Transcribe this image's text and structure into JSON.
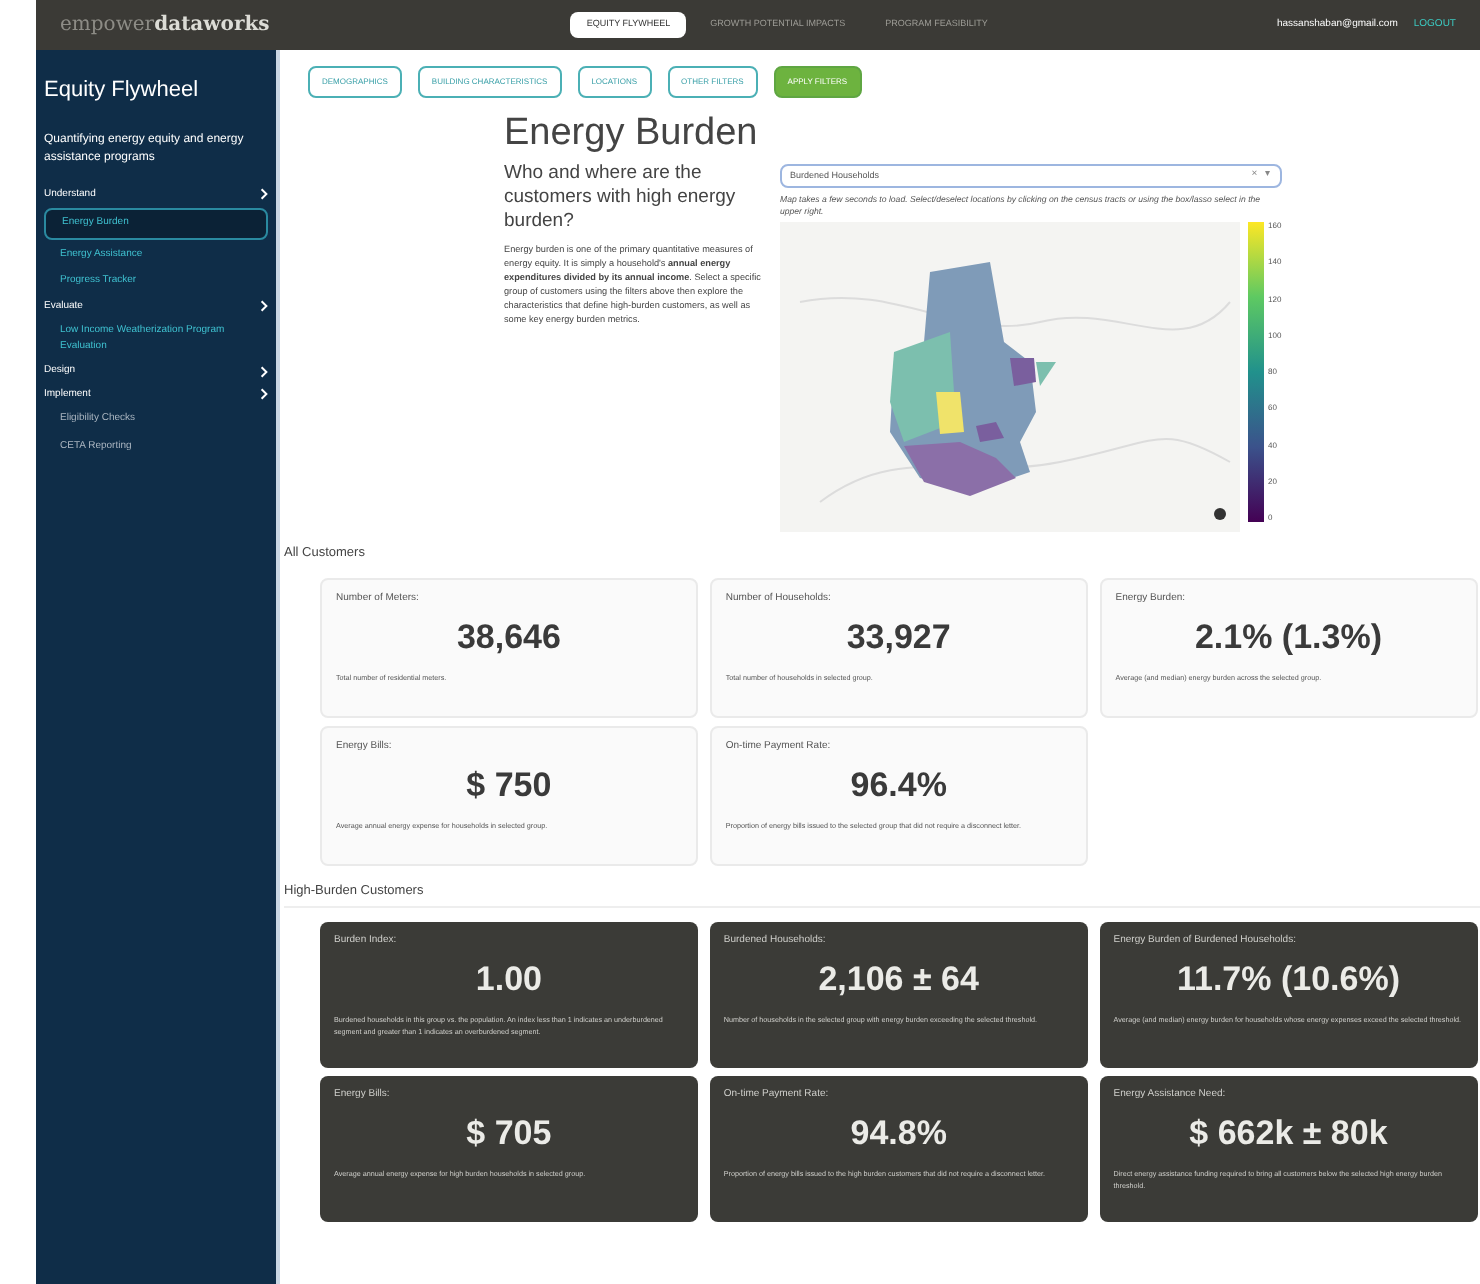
{
  "header": {
    "logo_light": "empower",
    "logo_bold": "dataworks",
    "tabs": [
      {
        "label": "EQUITY FLYWHEEL",
        "selected": true
      },
      {
        "label": "GROWTH POTENTIAL IMPACTS",
        "selected": false
      },
      {
        "label": "PROGRAM FEASIBILITY",
        "selected": false
      }
    ],
    "email": "hassanshaban@gmail.com",
    "logout": "LOGOUT"
  },
  "sidebar": {
    "title": "Equity Flywheel",
    "subtitle": "Quantifying energy equity and energy assistance programs",
    "items": [
      {
        "label": "Understand",
        "children": [
          {
            "label": "Energy Burden",
            "selected": true
          },
          {
            "label": "Energy Assistance",
            "selected": false
          },
          {
            "label": "Progress Tracker",
            "selected": false
          }
        ]
      },
      {
        "label": "Evaluate",
        "children": [
          {
            "label": "Low Income Weatherization Program Evaluation",
            "selected": false
          }
        ]
      },
      {
        "label": "Design"
      },
      {
        "label": "Implement",
        "children": [
          {
            "label": "Eligibility Checks",
            "selected": false
          },
          {
            "label": "CETA Reporting",
            "selected": false
          }
        ]
      }
    ]
  },
  "filters": [
    {
      "label": "DEMOGRAPHICS",
      "kind": "outline"
    },
    {
      "label": "BUILDING CHARACTERISTICS",
      "kind": "outline"
    },
    {
      "label": "LOCATIONS",
      "kind": "outline"
    },
    {
      "label": "OTHER FILTERS",
      "kind": "outline"
    },
    {
      "label": "APPLY FILTERS",
      "kind": "primary"
    }
  ],
  "page": {
    "title": "Energy Burden",
    "question": "Who and where are the customers with high energy burden?",
    "description": "Energy burden is one of the primary quantitative measures of energy equity. It is simply a household's **annual energy expenditures divided by its annual income**. Select a specific group of customers using the filters above then explore the characteristics that define high-burden customers, as well as some key energy burden metrics.",
    "dropdown": {
      "value": "Burdened Households",
      "clear": "×",
      "caret": "▾"
    },
    "map_note": "Map takes a few seconds to load. Select/deselect locations by clicking on the census tracts or using the box/lasso select in the upper right.",
    "colorbar_ticks": [
      "160",
      "140",
      "120",
      "100",
      "80",
      "60",
      "40",
      "20",
      "0"
    ]
  },
  "sections": [
    {
      "title": "All Customers",
      "kind": "light",
      "cards": [
        {
          "label": "Number of Meters:",
          "value": "38,646",
          "note": "Total number of residential meters."
        },
        {
          "label": "Number of Households:",
          "value": "33,927",
          "note": "Total number of households in selected group."
        },
        {
          "label": "Energy Burden:",
          "value": "2.1% (1.3%)",
          "note": "Average (and median) energy burden across the selected group."
        },
        {
          "label": "Energy Bills:",
          "value": "$ 750",
          "note": "Average annual energy expense for households in selected group."
        },
        {
          "label": "On-time Payment Rate:",
          "value": "96.4%",
          "note": "Proportion of energy bills issued to the selected group that did not require a disconnect letter."
        }
      ]
    },
    {
      "title": "High-Burden Customers",
      "kind": "dark",
      "cards": [
        {
          "label": "Burden Index:",
          "value": "1.00",
          "note": "Burdened households in this group vs. the population. An index less than 1 indicates an underburdened segment and greater than 1 indicates an overburdened segment."
        },
        {
          "label": "Burdened Households:",
          "value": "2,106 ± 64",
          "note": "Number of households in the selected group with energy burden exceeding the selected threshold."
        },
        {
          "label": "Energy Burden of Burdened Households:",
          "value": "11.7% (10.6%)",
          "note": "Average (and median) energy burden for households whose energy expenses exceed the selected threshold."
        },
        {
          "label": "Energy Bills:",
          "value": "$ 705",
          "note": "Average annual energy expense for high burden households in selected group."
        },
        {
          "label": "On-time Payment Rate:",
          "value": "94.8%",
          "note": "Proportion of energy bills issued to the high burden customers that did not require a disconnect letter."
        },
        {
          "label": "Energy Assistance Need:",
          "value": "$ 662k ± 80k",
          "note": "Direct energy assistance funding required to bring all customers below the selected high energy burden threshold."
        }
      ]
    }
  ]
}
